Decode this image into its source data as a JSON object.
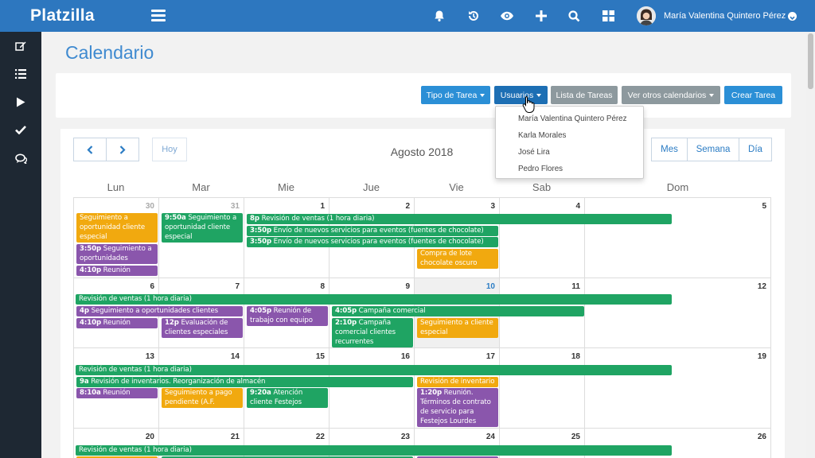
{
  "app": {
    "brand": "Platzilla"
  },
  "topbar": {
    "icons": [
      "bell-icon",
      "history-icon",
      "eye-icon",
      "plus-icon",
      "search-icon",
      "grid-icon"
    ],
    "user_name": "María Valentina Quintero Pérez"
  },
  "sidebar": {
    "items": [
      "edit-icon",
      "list-icon",
      "play-icon",
      "check-icon",
      "chat-icon"
    ]
  },
  "page": {
    "title": "Calendario"
  },
  "toolbar": {
    "tipo_tarea": "Tipo de Tarea",
    "usuarios": "Usuarios",
    "lista_tareas": "Lista de Tareas",
    "ver_otros": "Ver otros calendarios",
    "crear_tarea": "Crear Tarea"
  },
  "users_dropdown": [
    "María Valentina Quintero Pérez",
    "Karla Morales",
    "José Lira",
    "Pedro Flores"
  ],
  "calendar": {
    "today_label": "Hoy",
    "month_title": "Agosto 2018",
    "views": {
      "month": "Mes",
      "week": "Semana",
      "day": "Día"
    },
    "weekdays": [
      "Lun",
      "Mar",
      "Mie",
      "Jue",
      "Vie",
      "Sab",
      "Dom"
    ],
    "weeks": [
      [
        "30",
        "31",
        "1",
        "2",
        "3",
        "4",
        "5"
      ],
      [
        "6",
        "7",
        "8",
        "9",
        "10",
        "11",
        "12"
      ],
      [
        "13",
        "14",
        "15",
        "16",
        "17",
        "18",
        "19"
      ],
      [
        "20",
        "21",
        "22",
        "23",
        "24",
        "25",
        "26"
      ]
    ],
    "events": {
      "w1_a": "Seguimiento a oportunidad cliente especial",
      "w1_b_time": "3:50p",
      "w1_b": "Seguimiento a oportunidades",
      "w1_c_time": "4:10p",
      "w1_c": "Reunión semanal",
      "w1_d_time": "9:50a",
      "w1_d": "Seguimiento a oportunidad cliente especial",
      "w1_e_time": "8p",
      "w1_e": "Revisión de ventas (1 hora diaria)",
      "w1_f_time": "3:50p",
      "w1_f": "Envío de nuevos servicios para eventos (fuentes de chocolate)",
      "w1_g_time": "3:50p",
      "w1_g": "Envío de nuevos servicios para eventos (fuentes de chocolate)",
      "w1_h": "Compra de lote chocolate oscuro",
      "w2_a": "Revisión de ventas (1 hora diaria)",
      "w2_b_time": "4p",
      "w2_b": "Seguimiento a oportunidades clientes especiales",
      "w2_c_time": "4:10p",
      "w2_c": "Reunión semanal",
      "w2_d_time": "12p",
      "w2_d": "Evaluación de clientes especiales",
      "w2_e_time": "4:05p",
      "w2_e": "Reunión de trabajo con equipo",
      "w2_f_time": "4:05p",
      "w2_f": "Campaña comercial",
      "w2_g_time": "2:10p",
      "w2_g": "Campaña comercial clientes recurrentes",
      "w2_h": "Seguimiento a cliente especial",
      "w3_a": "Revisión de ventas (1 hora diaria)",
      "w3_b_time": "9a",
      "w3_b": "Revisión de inventarios. Reorganización de almacén",
      "w3_c_time": "8:10a",
      "w3_c": "Reunión semanal",
      "w3_d": "Seguimiento a pago pendiente (A.F. Lourdes)",
      "w3_e_time": "9:20a",
      "w3_e": "Atención cliente Festejos Lourdes",
      "w3_f": "Revisión de inventario",
      "w3_g_time": "1:20p",
      "w3_g": "Reunión. Términos de contrato de servicio para Festejos Lourdes",
      "w4_a": "Revisión de ventas (1 hora diaria)"
    }
  },
  "colors": {
    "brand": "#2d77bf",
    "sidebar": "#1e2833",
    "green": "#1fa463",
    "orange": "#f1a90f",
    "purple": "#8a56ac"
  }
}
